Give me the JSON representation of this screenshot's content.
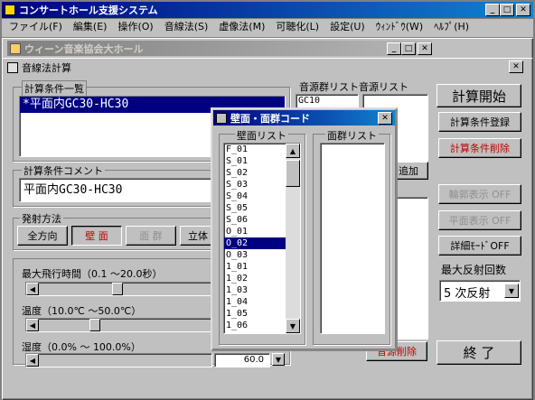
{
  "app": {
    "title": "コンサートホール支援システム",
    "menu": [
      "ファイル(F)",
      "編集(E)",
      "操作(O)",
      "音線法(S)",
      "虚像法(M)",
      "可聴化(L)",
      "設定(U)",
      "ｳｨﾝﾄﾞｳ(W)",
      "ﾍﾙﾌﾟ(H)"
    ]
  },
  "doc_window": {
    "title": "ウィーン音楽協会大ホール"
  },
  "calc_window": {
    "title": "音線法計算",
    "conditions_label": "計算条件一覧",
    "conditions_items": [
      "*平面内GC30-HC30"
    ],
    "comment_label": "計算条件コメント",
    "comment_value": "平面内GC30-HC30",
    "emission_label": "発射方法",
    "emission_buttons": [
      "全方向",
      "壁 面",
      "面 群",
      "立体"
    ],
    "max_flight_label": "最大飛行時間（0.1 ～20.0秒）",
    "temperature_label": "温度（10.0℃ ～50.0℃）",
    "humidity_label": "湿度（0.0% ～ 100.0%）",
    "humidity_value": "60.0",
    "source_list_label": "音源群リスト音源リスト",
    "source_group_item": "GC10",
    "add_button": "追加",
    "delete_source_button": "音源削除",
    "right_buttons": {
      "start": "計算開始",
      "register": "計算条件登録",
      "delete": "計算条件削除",
      "outline": "輪郭表示 OFF",
      "plane": "平面表示 OFF",
      "detail": "詳細ﾓｰﾄﾞOFF"
    },
    "max_reflection_label": "最大反射回数",
    "max_reflection_value": "5 次反射",
    "end_button": "終 了"
  },
  "dialog": {
    "title": "壁面・面群コード",
    "wall_list_label": "壁面リスト",
    "face_group_label": "面群リスト",
    "wall_items": [
      "F_01",
      "S_01",
      "S_02",
      "S_03",
      "S_04",
      "S_05",
      "S_06",
      "O_01",
      "O_02",
      "O_03",
      "1_01",
      "1_02",
      "1_03",
      "1_04",
      "1_05",
      "1_06"
    ],
    "selected_index": 8
  },
  "colors": {
    "title_active": "#000080",
    "selection": "#000080",
    "danger_text": "#c00000"
  }
}
